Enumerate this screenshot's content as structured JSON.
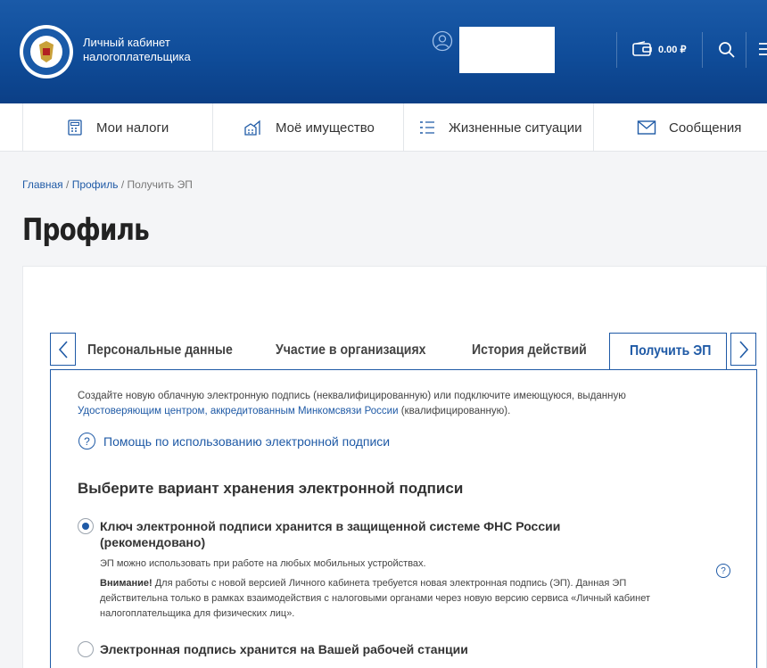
{
  "header": {
    "brand_line1": "Личный кабинет",
    "brand_line2": "налогоплательщика",
    "balance": "0.00 ₽",
    "accent": "#0f4c99"
  },
  "nav": {
    "items": [
      {
        "label": "Мои налоги",
        "icon": "calculator-icon"
      },
      {
        "label": "Моё имущество",
        "icon": "property-icon"
      },
      {
        "label": "Жизненные ситуации",
        "icon": "list-icon"
      },
      {
        "label": "Сообщения",
        "icon": "envelope-icon"
      }
    ]
  },
  "breadcrumb": {
    "home": "Главная",
    "sep1": " / ",
    "profile": "Профиль",
    "sep2": " / ",
    "current": "Получить ЭП"
  },
  "page": {
    "title": "Профиль"
  },
  "tabs": [
    {
      "label": "Персональные данные"
    },
    {
      "label": "Участие в организациях"
    },
    {
      "label": "История действий"
    },
    {
      "label": "Получить ЭП",
      "active": true
    }
  ],
  "content": {
    "intro_text": "Создайте новую облачную электронную подпись (неквалифицированную) или подключите имеющуюся, выданную",
    "intro_link": "Удостоверяющим центром, аккредитованным Минкомсвязи России",
    "intro_suffix": " (квалифицированную).",
    "help_link": "Помощь по использованию электронной подписи",
    "section_title": "Выберите вариант хранения электронной подписи",
    "option1": {
      "title_line1": "Ключ электронной подписи хранится в защищенной системе ФНС России",
      "title_line2": "(рекомендовано)",
      "desc": "ЭП можно использовать при работе на любых мобильных устройствах.",
      "warning_label": "Внимание!",
      "warning_text": " Для работы с новой версией Личного кабинета требуется новая электронная подпись (ЭП). Данная ЭП",
      "warning_line2": "действительна только в рамках взаимодействия с налоговыми органами через новую версию сервиса  «Личный кабинет",
      "warning_line3": "налогоплательщика для физических лиц».",
      "selected": true
    },
    "option2": {
      "title": "Электронная подпись хранится на Вашей рабочей станции",
      "selected": false
    }
  }
}
